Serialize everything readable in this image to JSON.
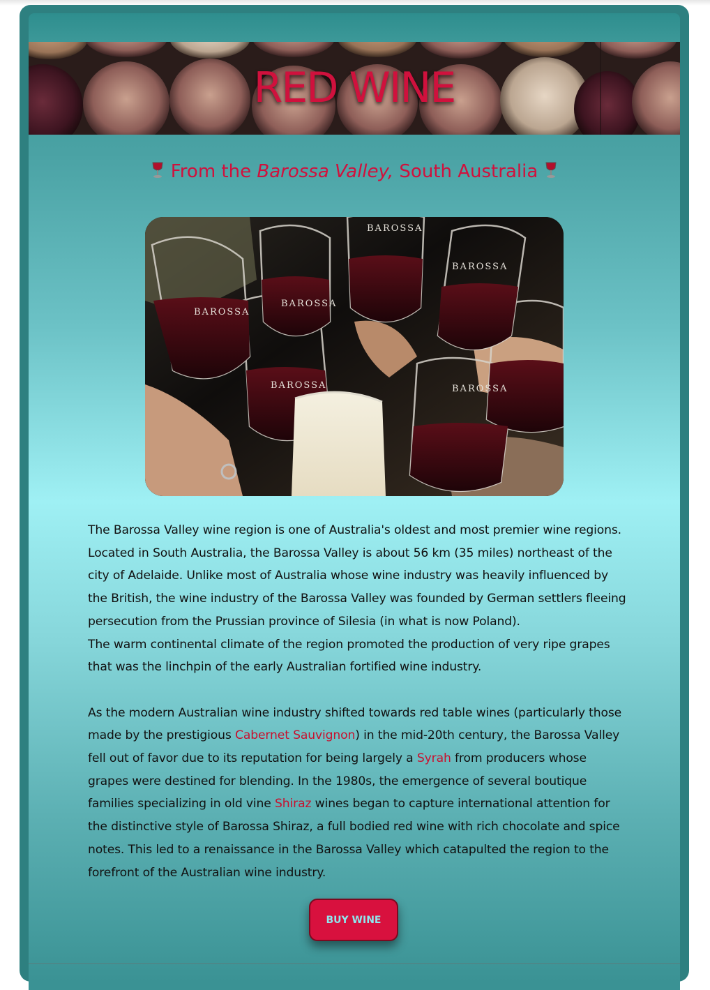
{
  "header": {
    "title": "RED WINE"
  },
  "subtitle": {
    "prefix": "From the ",
    "emphasis": "Barossa Valley,",
    "suffix": " South Australia",
    "icon": "wine-glass-icon"
  },
  "photo": {
    "glass_labels": [
      "BAROSSA",
      "BAROSSA",
      "BAROSSA",
      "BAROSSA",
      "BAROSSA",
      "BAROSSA"
    ]
  },
  "article": {
    "p1": "The Barossa Valley wine region is one of Australia's oldest and most premier wine regions. Located in South Australia, the Barossa Valley is about 56 km (35 miles) northeast of the city of Adelaide. Unlike most of Australia whose wine industry was heavily influenced by the British, the wine industry of the Barossa Valley was founded by German settlers fleeing persecution from the Prussian province of Silesia (in what is now Poland).",
    "p2": "The warm continental climate of the region promoted the production of very ripe grapes that was the linchpin of the early Australian fortified wine industry.",
    "p3": {
      "t1": "As the modern Australian wine industry shifted towards red table wines (particularly those made by the prestigious ",
      "link1": "Cabernet Sauvignon",
      "t2": ") in the mid-20th century, the Barossa Valley fell out of favor due to its reputation for being largely a ",
      "link2": "Syrah",
      "t3": " from producers whose grapes were destined for blending. In the 1980s, the emergence of several boutique families specializing in old vine ",
      "link3": "Shiraz",
      "t4": " wines began to capture international attention for the distinctive style of Barossa Shiraz, a full bodied red wine with rich chocolate and spice notes. This led to a renaissance in the Barossa Valley which catapulted the region to the forefront of the Australian wine industry."
    }
  },
  "cta": {
    "label": "BUY WINE"
  },
  "colors": {
    "accent": "#d0113d",
    "frame": "#2e8080",
    "button_text": "#8ee8ee"
  }
}
